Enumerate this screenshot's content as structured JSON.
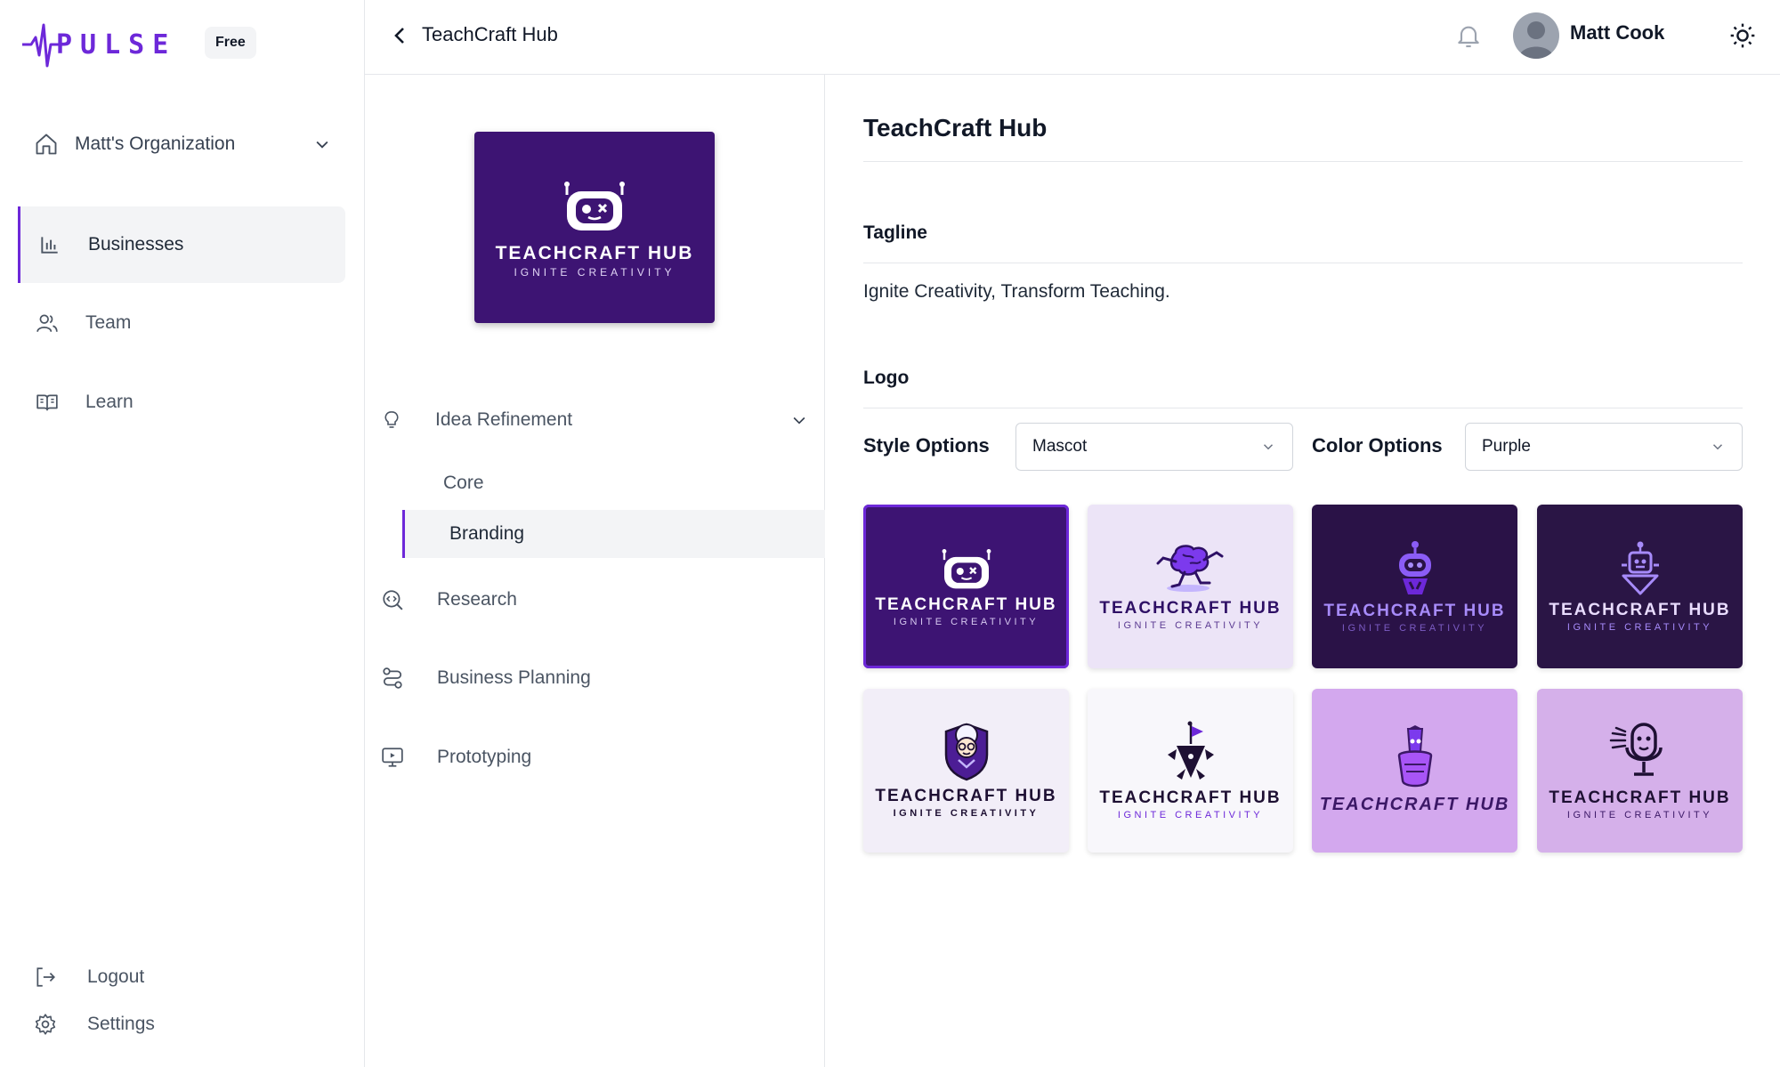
{
  "brand": {
    "name": "PULSE",
    "plan_badge": "Free"
  },
  "sidebar": {
    "org_name": "Matt's Organization",
    "nav": [
      {
        "label": "Businesses",
        "icon": "bar-chart-icon",
        "active": true
      },
      {
        "label": "Team",
        "icon": "users-icon",
        "active": false
      },
      {
        "label": "Learn",
        "icon": "book-open-icon",
        "active": false
      }
    ],
    "bottom": [
      {
        "label": "Logout",
        "icon": "logout-icon"
      },
      {
        "label": "Settings",
        "icon": "gear-icon"
      }
    ]
  },
  "header": {
    "breadcrumb": "TeachCraft Hub",
    "user_name": "Matt Cook"
  },
  "project": {
    "logo_name": "TEACHCRAFT HUB",
    "logo_sub": "IGNITE CREATIVITY",
    "sections": [
      {
        "label": "Idea Refinement",
        "icon": "lightbulb-icon",
        "expanded": true,
        "children": [
          {
            "label": "Core",
            "active": false
          },
          {
            "label": "Branding",
            "active": true
          }
        ]
      },
      {
        "label": "Research",
        "icon": "search-code-icon"
      },
      {
        "label": "Business Planning",
        "icon": "route-icon"
      },
      {
        "label": "Prototyping",
        "icon": "presentation-icon"
      }
    ]
  },
  "content": {
    "title": "TeachCraft Hub",
    "tagline_label": "Tagline",
    "tagline": "Ignite Creativity, Transform Teaching.",
    "logo_label": "Logo",
    "style_label": "Style Options",
    "style_value": "Mascot",
    "color_label": "Color Options",
    "color_value": "Purple",
    "logo_options": [
      {
        "name": "TEACHCRAFT HUB",
        "sub": "IGNITE CREATIVITY",
        "mascot": "robot-face",
        "bg": "#3d1473",
        "fg": "#ffffff",
        "sub_fg": "#d6c8f0",
        "selected": true
      },
      {
        "name": "TEACHCRAFT HUB",
        "sub": "IGNITE CREATIVITY",
        "mascot": "running-brain",
        "bg": "#ece4f7",
        "fg": "#2e1065",
        "sub_fg": "#5b3a92",
        "selected": false
      },
      {
        "name": "TEACHCRAFT HUB",
        "sub": "IGNITE CREATIVITY",
        "mascot": "robot-head",
        "bg": "#2a1247",
        "fg": "#a78bfa",
        "sub_fg": "#7c5cc4",
        "selected": false
      },
      {
        "name": "TEACHCRAFT HUB",
        "sub": "IGNITE CREATIVITY",
        "mascot": "robot-small",
        "bg": "#2a1545",
        "fg": "#e9dcff",
        "sub_fg": "#a78bfa",
        "selected": false
      },
      {
        "name": "TEACHCRAFT HUB",
        "sub": "IGNITE CREATIVITY",
        "mascot": "professor-crest",
        "bg": "#f2eef8",
        "fg": "#1e1033",
        "sub_fg": "#1e1033",
        "selected": false
      },
      {
        "name": "TEACHCRAFT HUB",
        "sub": "IGNITE CREATIVITY",
        "mascot": "wizard-flag",
        "bg": "#f8f7fb",
        "fg": "#1e1033",
        "sub_fg": "#6d28d9",
        "selected": false
      },
      {
        "name": "TEACHCRAFT HUB",
        "sub": "",
        "mascot": "pencil-wizard",
        "bg": "#d3a8ee",
        "fg": "#3b1866",
        "sub_fg": "#3b1866",
        "selected": false
      },
      {
        "name": "TEACHCRAFT HUB",
        "sub": "IGNITE CREATIVITY",
        "mascot": "microphone-face",
        "bg": "#d5b0ea",
        "fg": "#1e1033",
        "sub_fg": "#3b1866",
        "selected": false
      }
    ]
  },
  "colors": {
    "accent": "#6d28d9",
    "border": "#e5e7eb",
    "active_bg": "#f3f4f6"
  }
}
